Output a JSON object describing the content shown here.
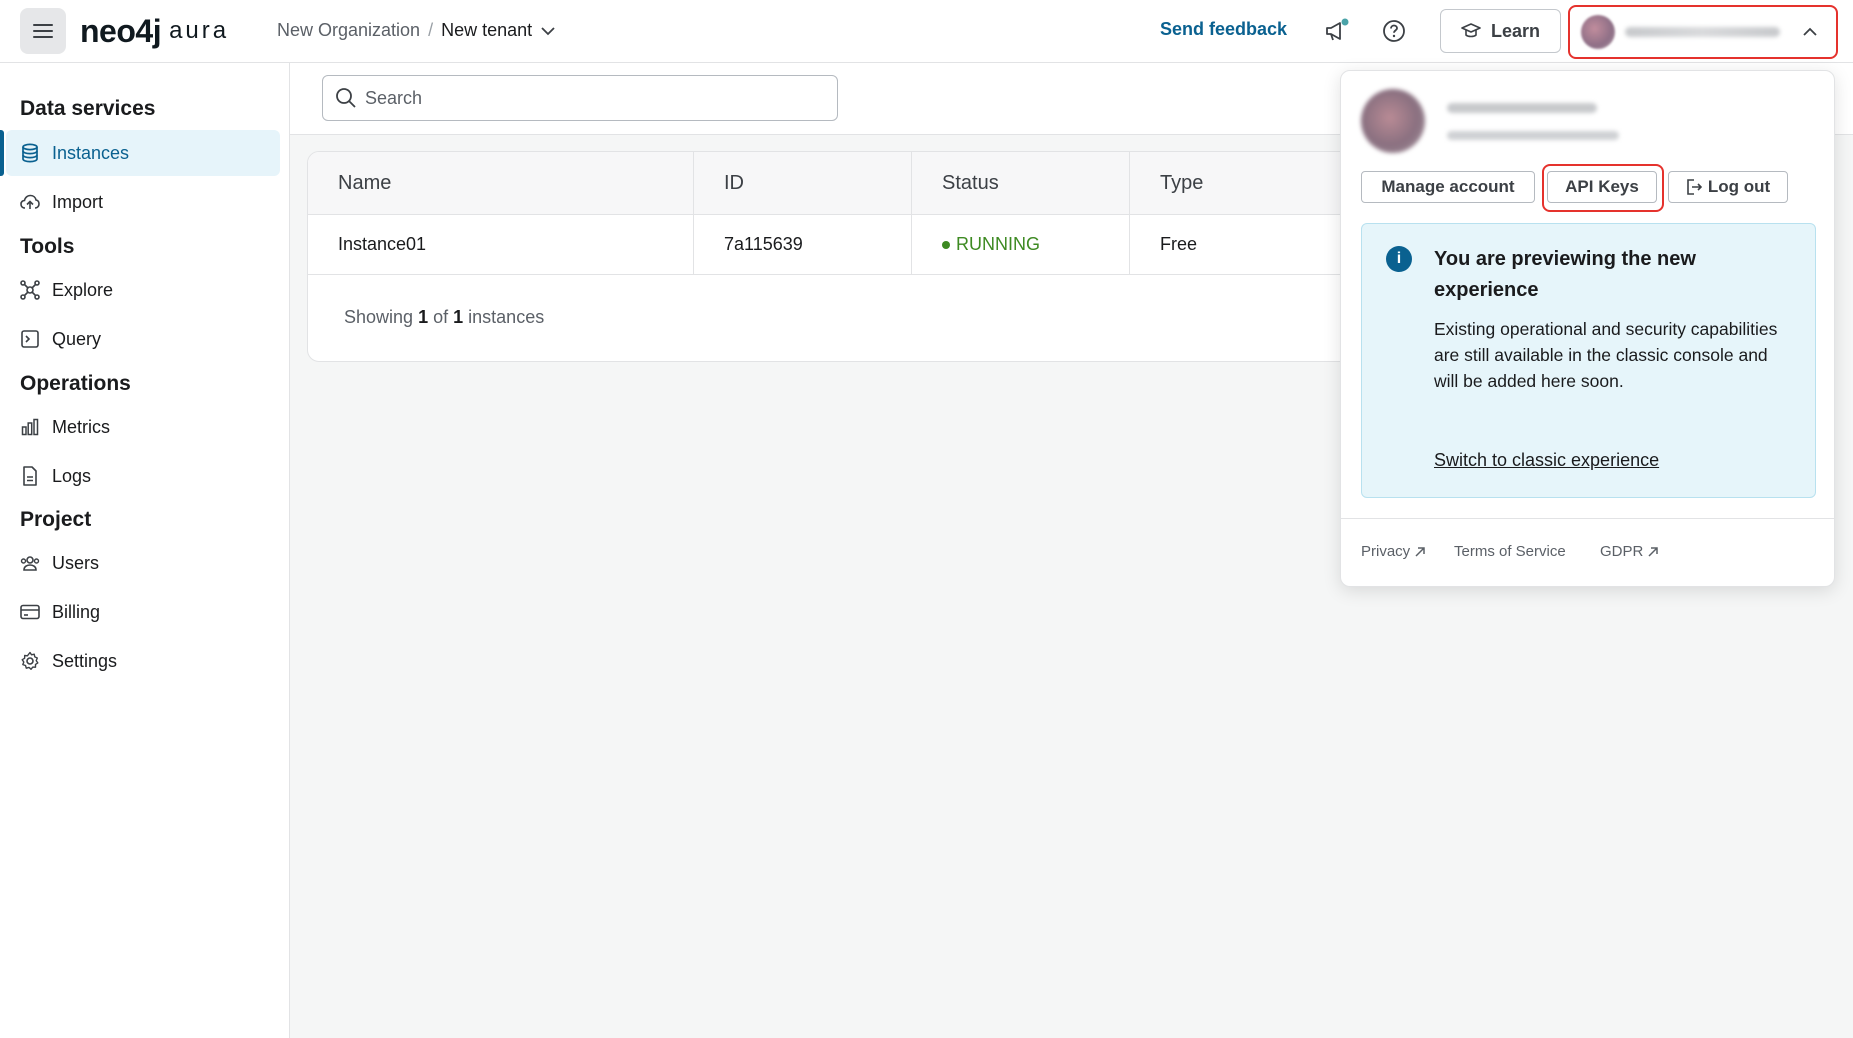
{
  "header": {
    "logo_main": "neo4j",
    "logo_sub": "aura",
    "org": "New Organization",
    "separator": "/",
    "tenant": "New tenant",
    "send_feedback": "Send feedback",
    "learn_label": "Learn"
  },
  "sidebar": {
    "sections": [
      {
        "title": "Data services"
      },
      {
        "title": "Tools"
      },
      {
        "title": "Operations"
      },
      {
        "title": "Project"
      }
    ],
    "items": [
      {
        "label": "Instances",
        "icon": "database-icon",
        "active": true
      },
      {
        "label": "Import",
        "icon": "cloud-upload-icon"
      },
      {
        "label": "Explore",
        "icon": "graph-icon"
      },
      {
        "label": "Query",
        "icon": "terminal-icon"
      },
      {
        "label": "Metrics",
        "icon": "bar-chart-icon"
      },
      {
        "label": "Logs",
        "icon": "document-icon"
      },
      {
        "label": "Users",
        "icon": "users-icon"
      },
      {
        "label": "Billing",
        "icon": "credit-card-icon"
      },
      {
        "label": "Settings",
        "icon": "gear-icon"
      }
    ]
  },
  "search": {
    "placeholder": "Search"
  },
  "table": {
    "columns": [
      "Name",
      "ID",
      "Status",
      "Type"
    ],
    "rows": [
      {
        "name": "Instance01",
        "id": "7a115639",
        "status": "RUNNING",
        "type": "Free"
      }
    ],
    "footer_prefix": "Showing",
    "footer_shown": "1",
    "footer_of": "of",
    "footer_total": "1",
    "footer_suffix": "instances"
  },
  "dropdown": {
    "manage_account": "Manage account",
    "api_keys": "API Keys",
    "log_out": "Log out",
    "info_title": "You are previewing the new experience",
    "info_body": "Existing operational and security capabilities are still available in the classic console and will be added here soon.",
    "info_link": "Switch to classic experience",
    "footer_links": [
      "Privacy",
      "Terms of Service",
      "GDPR"
    ]
  },
  "colors": {
    "accent": "#0a6190",
    "running": "#3d8a22",
    "highlight": "#e5322d"
  }
}
